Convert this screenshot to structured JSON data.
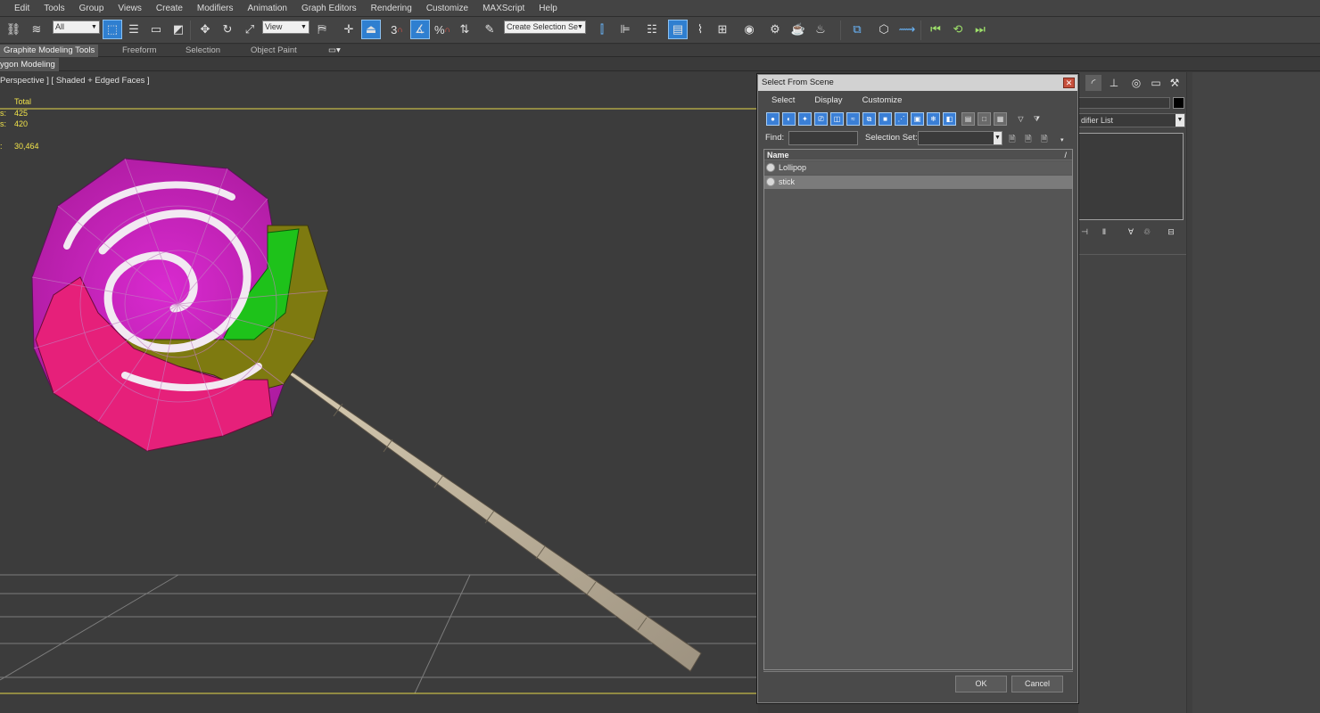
{
  "menu": [
    "Edit",
    "Tools",
    "Group",
    "Views",
    "Create",
    "Modifiers",
    "Animation",
    "Graph Editors",
    "Rendering",
    "Customize",
    "MAXScript",
    "Help"
  ],
  "toolbar": {
    "selection_filter": "All",
    "reference_coord": "View",
    "named_selection_set": "Create Selection Se",
    "snap_label": "3",
    "percent_snap_label": "%"
  },
  "ribbon": {
    "tabs": [
      "Graphite Modeling Tools",
      "Freeform",
      "Selection",
      "Object Paint"
    ],
    "active_subtab": "ygon Modeling"
  },
  "viewport": {
    "label": "Perspective ] [ Shaded + Edged Faces ]",
    "stats_header": "Total",
    "stats": [
      {
        "key": "s:",
        "value": "425"
      },
      {
        "key": "s:",
        "value": "420"
      },
      {
        "key": ":",
        "value": "30,464"
      }
    ],
    "colors": {
      "grid": "#8a8a8a",
      "axis": "#e6d84a"
    }
  },
  "dialog": {
    "title": "Select From Scene",
    "close_glyph": "✕",
    "menu": [
      "Select",
      "Display",
      "Customize"
    ],
    "find_label": "Find:",
    "selection_set_label": "Selection Set:",
    "list_header": "Name",
    "list_sort_glyph": "/",
    "objects": [
      {
        "name": "Lollipop"
      },
      {
        "name": "stick"
      }
    ],
    "ok_label": "OK",
    "cancel_label": "Cancel"
  },
  "command_panel": {
    "modifier_list": "difier List",
    "tab_icons": [
      "modify-icon",
      "hierarchy-icon",
      "motion-icon",
      "display-icon",
      "utilities-icon"
    ]
  }
}
